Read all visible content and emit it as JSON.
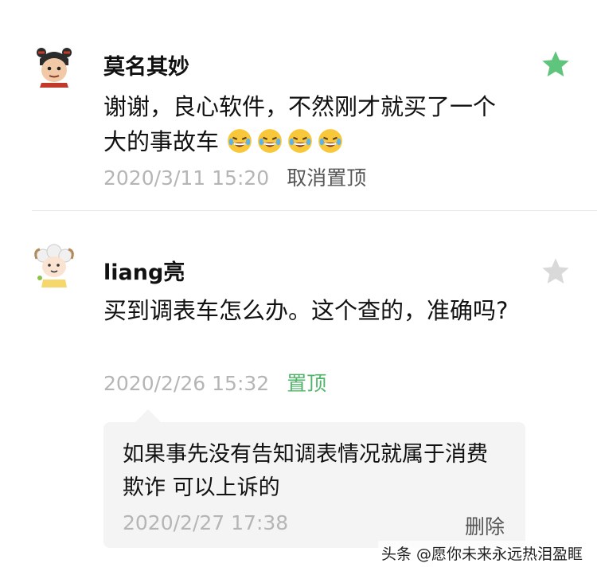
{
  "comments": [
    {
      "author": "莫名其妙",
      "text": "谢谢，良心软件，不然刚才就买了一个大的事故车",
      "emoji_count": 4,
      "timestamp": "2020/3/11 15:20",
      "action_label": "取消置顶",
      "starred": true
    },
    {
      "author": "liang亮",
      "text": "买到调表车怎么办。这个查的，准确吗?",
      "timestamp": "2020/2/26 15:32",
      "action_label": "置顶",
      "starred": false,
      "reply": {
        "text": "如果事先没有告知调表情况就属于消费欺诈 可以上诉的",
        "timestamp": "2020/2/27 17:38",
        "delete_label": "删除"
      }
    }
  ],
  "watermark": "头条 @愿你未来永远热泪盈眶",
  "colors": {
    "star_active": "#5fc47c",
    "star_inactive": "#d9d9d9",
    "pin_green": "#4fb368",
    "meta_gray": "#b5b5b5"
  }
}
